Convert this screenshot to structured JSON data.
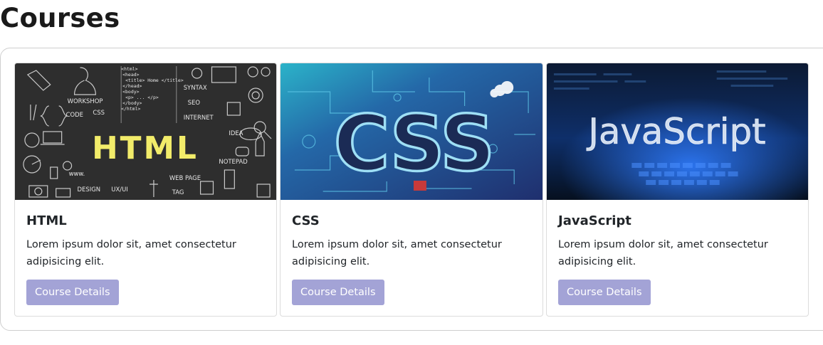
{
  "page": {
    "title": "Courses"
  },
  "colors": {
    "button_bg": "#a3a3d6",
    "button_text": "#ffffff",
    "border": "#dcdcdc"
  },
  "courses": [
    {
      "title": "HTML",
      "description": "Lorem ipsum dolor sit, amet consectetur adipisicing elit.",
      "button_label": "Course Details",
      "image": {
        "banner_text": "HTML",
        "doodle_labels": [
          "WORKSHOP",
          "CODE",
          "CSS",
          "SYNTAX",
          "SEO",
          "INTERNET",
          "IDEA",
          "NOTEPAD",
          "www.",
          "DESIGN",
          "UX/UI",
          "WEB PAGE",
          "TAG"
        ],
        "code_lines": [
          "<html>",
          "<head>",
          "<title> Home </title>",
          "</head>",
          "<body>",
          "<p> ... </p>",
          "</body>",
          "</html>"
        ]
      }
    },
    {
      "title": "CSS",
      "description": "Lorem ipsum dolor sit, amet consectetur adipisicing elit.",
      "button_label": "Course Details",
      "image": {
        "banner_text": "CSS"
      }
    },
    {
      "title": "JavaScript",
      "description": "Lorem ipsum dolor sit, amet consectetur adipisicing elit.",
      "button_label": "Course Details",
      "image": {
        "banner_text": "JavaScript"
      }
    }
  ]
}
